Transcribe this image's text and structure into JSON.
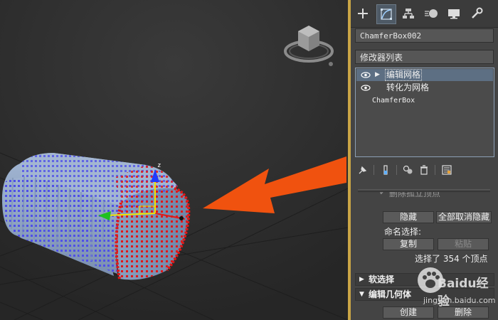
{
  "panel": {
    "tabs": [
      {
        "name": "create",
        "icon": "plus-icon"
      },
      {
        "name": "modify",
        "icon": "modify-curve-icon"
      },
      {
        "name": "hierarchy",
        "icon": "hierarchy-icon"
      },
      {
        "name": "motion",
        "icon": "motion-icon"
      },
      {
        "name": "display",
        "icon": "display-monitor-icon"
      },
      {
        "name": "utilities",
        "icon": "wrench-icon"
      }
    ],
    "object_name": "ChamferBox002",
    "modifier_list_label": "修改器列表",
    "stack": {
      "items": [
        {
          "label": "编辑网格",
          "expandable": true,
          "visible_eye": true
        },
        {
          "label": "转化为网格",
          "expandable": false,
          "visible_eye": true
        },
        {
          "label": "ChamferBox",
          "expandable": false,
          "visible_eye": false
        }
      ]
    },
    "toolbar": [
      "pin-icon",
      "show-end-result-icon",
      "make-unique-icon",
      "remove-modifier-icon",
      "configure-sets-icon"
    ],
    "selection": {
      "delete_isolated_label": "删除孤立顶点",
      "hide_button": "隐藏",
      "unhide_all_button": "全部取消隐藏",
      "named_selections_label": "命名选择:",
      "copy_button": "复制",
      "paste_button": "粘贴",
      "status": "选择了 354 个顶点"
    },
    "rollouts": {
      "soft_selection": "软选择",
      "edit_geometry": "编辑几何体"
    },
    "edit_geometry": {
      "create_button": "创建",
      "delete_button": "删除"
    }
  },
  "viewport": {
    "gizmo_axis_label": "z"
  },
  "watermark": {
    "brand": "Baidu经验",
    "url": "jingyan.baidu.com"
  },
  "colors": {
    "highlight_arrow": "#f0520f",
    "selected_vertex": "#e01818",
    "unselected_vertex": "#4f4fe8",
    "panel_border_accent": "#c9a546"
  }
}
